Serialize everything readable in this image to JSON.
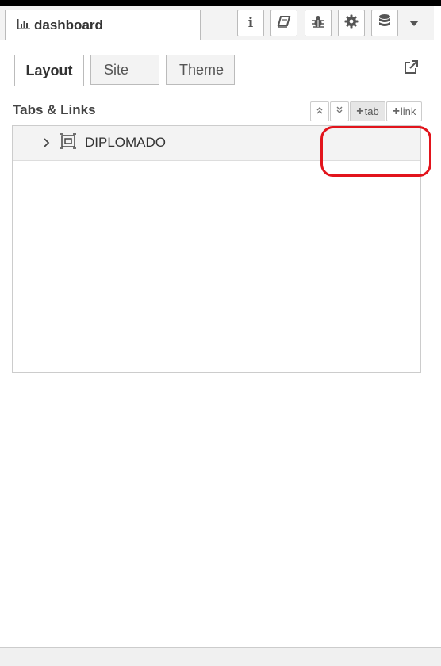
{
  "sidebar": {
    "tab_label": "dashboard",
    "header_buttons": [
      {
        "name": "info-button",
        "icon": "info-icon",
        "glyph": "i"
      },
      {
        "name": "help-button",
        "icon": "book-icon"
      },
      {
        "name": "debug-button",
        "icon": "bug-icon"
      },
      {
        "name": "config-button",
        "icon": "gear-icon"
      },
      {
        "name": "context-data-button",
        "icon": "database-icon"
      }
    ]
  },
  "dashboard": {
    "tabs": [
      {
        "label": "Layout",
        "active": true
      },
      {
        "label": "Site",
        "active": false
      },
      {
        "label": "Theme",
        "active": false
      }
    ],
    "section_title": "Tabs & Links",
    "toolbar": {
      "add_tab_label": "tab",
      "add_link_label": "link"
    },
    "tree": [
      {
        "label": "DIPLOMADO",
        "icon": "dashboard-tab-icon",
        "expanded": false
      }
    ]
  },
  "colors": {
    "highlight": "#e2141c",
    "header_bg": "#f3f3f3",
    "border": "#bbbbbb"
  }
}
